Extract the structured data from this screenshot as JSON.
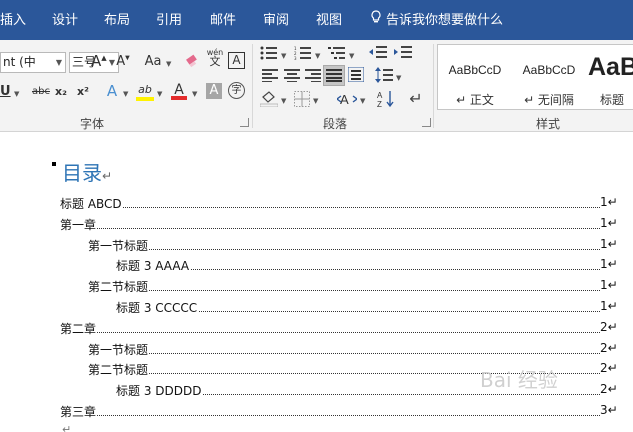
{
  "menubar": {
    "tabs": [
      "插入",
      "设计",
      "布局",
      "引用",
      "邮件",
      "审阅",
      "视图"
    ],
    "tell_me": "告诉我你想要做什么"
  },
  "ribbon": {
    "font": {
      "name_value": "nt (中",
      "size_value": "三号",
      "grow": "A",
      "shrink": "A",
      "change_case": "Aa",
      "wen": "wén",
      "wen_char": "文",
      "charborder": "A",
      "underline": "U",
      "strike": "abc",
      "sub": "x₂",
      "sup": "x²",
      "effects": "A",
      "highlight": "ab",
      "color": "A",
      "shade": "A",
      "enclose": "字",
      "label": "字体"
    },
    "paragraph": {
      "label": "段落"
    },
    "styles": {
      "cards": [
        {
          "sample": "AaBbCcD",
          "name": "↵ 正文"
        },
        {
          "sample": "AaBbCcD",
          "name": "↵ 无间隔"
        },
        {
          "sample": "AaB",
          "name": "标题"
        }
      ],
      "label": "样式"
    }
  },
  "document": {
    "toc_title": "目录",
    "return_mark": "↵",
    "entries": [
      {
        "text": "标题 ABCD",
        "page": "1↵",
        "level": 0
      },
      {
        "text": "第一章",
        "page": "1↵",
        "level": 0
      },
      {
        "text": "第一节标题",
        "page": "1↵",
        "level": 1
      },
      {
        "text": "标题 3 AAAA",
        "page": "1↵",
        "level": 2
      },
      {
        "text": "第二节标题",
        "page": "1↵",
        "level": 1
      },
      {
        "text": "标题 3 CCCCC",
        "page": "1↵",
        "level": 2
      },
      {
        "text": "第二章",
        "page": "2↵",
        "level": 0
      },
      {
        "text": "第一节标题",
        "page": "2↵",
        "level": 1
      },
      {
        "text": "第二节标题",
        "page": "2↵",
        "level": 1
      },
      {
        "text": "标题 3 DDDDD",
        "page": "2↵",
        "level": 2
      },
      {
        "text": "第三章",
        "page": "3↵",
        "level": 0
      }
    ],
    "trailing_mark": "↵"
  },
  "watermark": "Bai 经验"
}
